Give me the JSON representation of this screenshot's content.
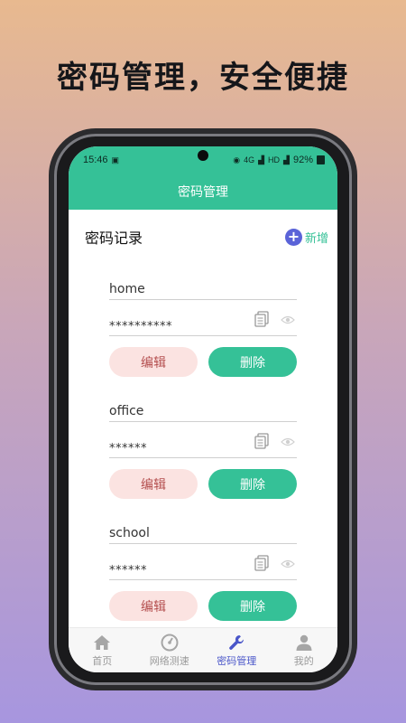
{
  "headline": "密码管理，安全便捷",
  "status_bar": {
    "time": "15:46",
    "battery": "92%",
    "net_label": "4G",
    "hd_label": "HD"
  },
  "app_bar": {
    "title": "密码管理"
  },
  "section": {
    "title": "密码记录",
    "add_label": "新增"
  },
  "records": [
    {
      "name": "home",
      "password_mask": "**********",
      "edit_label": "编辑",
      "delete_label": "删除"
    },
    {
      "name": "office",
      "password_mask": "******",
      "edit_label": "编辑",
      "delete_label": "删除"
    },
    {
      "name": "school",
      "password_mask": "******",
      "edit_label": "编辑",
      "delete_label": "删除"
    }
  ],
  "nav": {
    "items": [
      {
        "label": "首页",
        "icon": "home-icon"
      },
      {
        "label": "网络测速",
        "icon": "speedometer-icon"
      },
      {
        "label": "密码管理",
        "icon": "wrench-icon",
        "active": true
      },
      {
        "label": "我的",
        "icon": "user-icon"
      }
    ]
  },
  "colors": {
    "primary": "#35c197",
    "accent": "#4a56c9",
    "edit_bg": "#fbe3e1",
    "edit_text": "#b44f4f"
  }
}
